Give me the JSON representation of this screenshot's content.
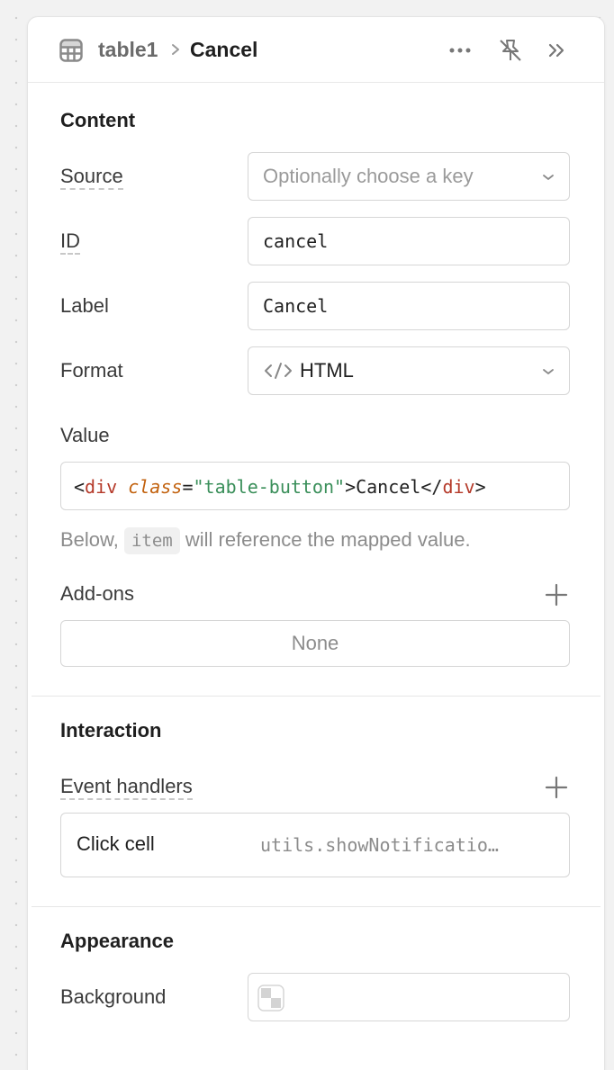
{
  "header": {
    "parent": "table1",
    "current": "Cancel",
    "icons": [
      "table-icon",
      "chevron-right-icon",
      "more-icon",
      "unpin-icon",
      "collapse-panel-icon"
    ]
  },
  "content": {
    "title": "Content",
    "source_label": "Source",
    "source_placeholder": "Optionally choose a key",
    "id_label": "ID",
    "id_value": "cancel",
    "label_label": "Label",
    "label_value": "Cancel",
    "format_label": "Format",
    "format_value": "HTML",
    "value_label": "Value",
    "value_code": {
      "lt": "<",
      "tag": "div",
      "attr": "class",
      "eq": "=",
      "str": "\"table-button\"",
      "text": ">Cancel</",
      "close_tag": "div",
      "gt": ">"
    },
    "hint_prefix": "Below,",
    "hint_chip": "item",
    "hint_suffix": "will reference the mapped value.",
    "addons_label": "Add-ons",
    "addons_value": "None"
  },
  "interaction": {
    "title": "Interaction",
    "handlers_label": "Event handlers",
    "handler_event": "Click cell",
    "handler_action": "utils.showNotificatio…"
  },
  "appearance": {
    "title": "Appearance",
    "background_label": "Background"
  },
  "colors": {
    "tag": "#b53a2a",
    "attr": "#c2620f",
    "string": "#3a8f5a"
  }
}
